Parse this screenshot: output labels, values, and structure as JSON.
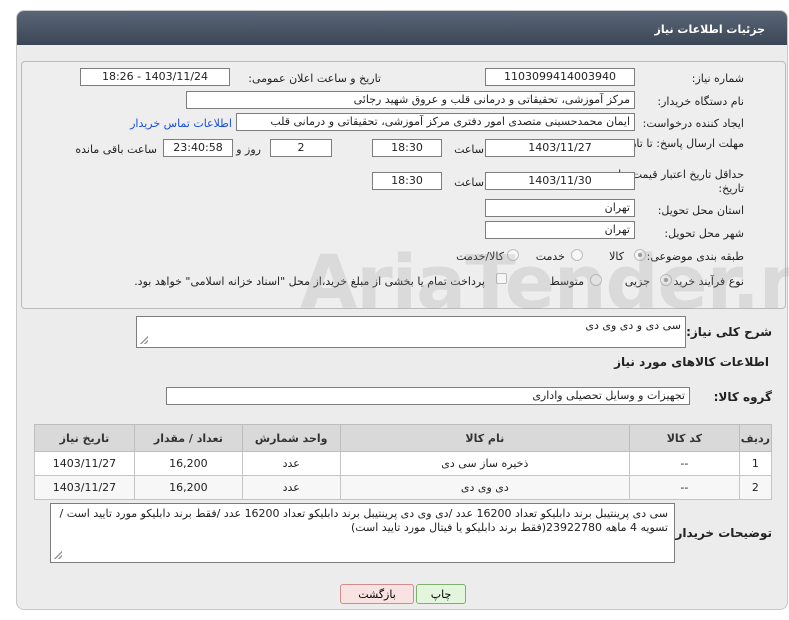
{
  "header": {
    "title": "جزئیات اطلاعات نیاز"
  },
  "form": {
    "need_number_label": "شماره نیاز:",
    "need_number": "1103099414003940",
    "announce_label": "تاریخ و ساعت اعلان عمومی:",
    "announce_value": "1403/11/24 - 18:26",
    "buyer_org_label": "نام دستگاه خریدار:",
    "buyer_org": "مرکز آموزشی، تحقیقاتی و درمانی قلب و عروق شهید رجائی",
    "creator_label": "ایجاد کننده درخواست:",
    "creator": "ایمان محمدحسینی متصدی امور دفتری مرکز آموزشی، تحقیقاتی و درمانی قلب",
    "contact_link": "اطلاعات تماس خریدار",
    "deadline_label": "مهلت ارسال پاسخ: تا تاریخ:",
    "deadline_date": "1403/11/27",
    "time_label": "ساعت",
    "deadline_time": "18:30",
    "days_value": "2",
    "days_label": "روز و",
    "remaining_time": "23:40:58",
    "remaining_label": "ساعت باقی مانده",
    "validity_label": "حداقل تاریخ اعتبار قیمت: تا تاریخ:",
    "validity_date": "1403/11/30",
    "validity_time": "18:30",
    "province_label": "استان محل تحویل:",
    "province": "تهران",
    "city_label": "شهر محل تحویل:",
    "city": "تهران",
    "category_label": "طبقه بندی موضوعی:",
    "category_options": [
      "کالا",
      "خدمت",
      "کالا/خدمت"
    ],
    "process_label": "نوع فرآیند خرید :",
    "process_options": [
      "جزیی",
      "متوسط"
    ],
    "payment_note": "پرداخت تمام یا بخشی از مبلغ خرید،از محل \"اسناد خزانه اسلامی\" خواهد بود."
  },
  "summary": {
    "label": "شرح کلی نیاز:",
    "value": "سی دی و دی وی دی"
  },
  "goods": {
    "section_title": "اطلاعات کالاهای مورد نیاز",
    "group_label": "گروه کالا:",
    "group_value": "تجهیزات و وسایل تحصیلی واداری",
    "columns": [
      "ردیف",
      "کد کالا",
      "نام کالا",
      "واحد شمارش",
      "تعداد / مقدار",
      "تاریخ نیاز"
    ],
    "rows": [
      {
        "row": "1",
        "code": "--",
        "name": "ذخیره ساز سی دی",
        "unit": "عدد",
        "qty": "16,200",
        "date": "1403/11/27"
      },
      {
        "row": "2",
        "code": "--",
        "name": "دی وی دی",
        "unit": "عدد",
        "qty": "16,200",
        "date": "1403/11/27"
      }
    ]
  },
  "buyer_notes": {
    "label": "توضیحات خریدار:",
    "text": "سی دی پرینتیبل برند دابلیکو تعداد 16200 عدد /دی وی دی پرینتیبل برند دابلیکو تعداد 16200 عدد /فقط برند دابلیکو مورد تایید است /تسویه 4 ماهه 23922780(فقط برند دابلیکو یا فیتال مورد تایید است)"
  },
  "buttons": {
    "print": "چاپ",
    "back": "بازگشت"
  },
  "watermark": "AriaTender.net"
}
